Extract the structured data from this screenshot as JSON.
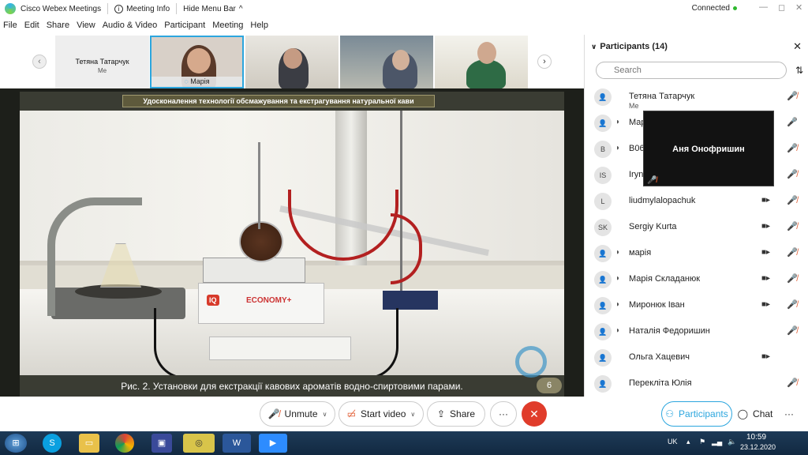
{
  "titlebar": {
    "app": "Cisco Webex Meetings",
    "meeting_info": "Meeting Info",
    "hide_menu": "Hide Menu Bar",
    "chevron": "^",
    "connected": "Connected"
  },
  "window_controls": {
    "minimize": "—",
    "maximize": "◻",
    "close": "✕"
  },
  "menu": [
    "File",
    "Edit",
    "Share",
    "View",
    "Audio & Video",
    "Participant",
    "Meeting",
    "Help"
  ],
  "strip": {
    "me_name": "Тетяна Татарчук",
    "me_sub": "Me",
    "active_label": "Марія",
    "prev": "‹",
    "next": "›"
  },
  "slide": {
    "title": "Удосконалення технології обсмажування та екстрагування натуральної  кави",
    "caption": "Рис. 2. Установки для екстракції кавових ароматів водно-спиртовими парами.",
    "page": "6",
    "box1": "ECONOMY+",
    "box_logo": "IQ"
  },
  "panel": {
    "title": "Participants (14)",
    "search_placeholder": "Search",
    "participants": [
      {
        "initials": "",
        "name": "Тетяна Татарчук",
        "sub": "Me",
        "cam": false,
        "mic": "muted",
        "wave": false
      },
      {
        "initials": "",
        "name": "Марія",
        "sub": "",
        "cam": false,
        "mic": "on",
        "wave": true
      },
      {
        "initials": "B",
        "name": "B06",
        "sub": "",
        "cam": false,
        "mic": "muted",
        "wave": true
      },
      {
        "initials": "IS",
        "name": "Iryna",
        "sub": "",
        "cam": false,
        "mic": "muted",
        "wave": false
      },
      {
        "initials": "L",
        "name": "liudmylalopachuk",
        "sub": "",
        "cam": true,
        "mic": "muted",
        "wave": false
      },
      {
        "initials": "SK",
        "name": "Sergiy Kurta",
        "sub": "",
        "cam": true,
        "mic": "muted",
        "wave": false
      },
      {
        "initials": "",
        "name": "марія",
        "sub": "",
        "cam": true,
        "mic": "muted",
        "wave": true
      },
      {
        "initials": "",
        "name": "Марія Складанюк",
        "sub": "",
        "cam": true,
        "mic": "muted",
        "wave": true
      },
      {
        "initials": "",
        "name": "Миронюк Іван",
        "sub": "",
        "cam": true,
        "mic": "muted",
        "wave": true
      },
      {
        "initials": "",
        "name": "Наталія Федоришин",
        "sub": "",
        "cam": false,
        "mic": "muted",
        "wave": true
      },
      {
        "initials": "",
        "name": "Ольга Хацевич",
        "sub": "",
        "cam": true,
        "mic": "none",
        "wave": false
      },
      {
        "initials": "",
        "name": "Перекліта Юлія",
        "sub": "",
        "cam": false,
        "mic": "muted",
        "wave": false
      }
    ]
  },
  "popup": {
    "name": "Аня Онофришин"
  },
  "controls": {
    "unmute": "Unmute",
    "start_video": "Start video",
    "share": "Share",
    "more": "···",
    "participants": "Participants",
    "chat": "Chat",
    "more2": "···"
  },
  "tray": {
    "lang": "UK",
    "time": "10:59",
    "date": "23.12.2020"
  },
  "colors": {
    "accent": "#2ca6de",
    "end": "#e03c2b",
    "muted": "#e0562b",
    "unmuted": "#2eb82e"
  }
}
